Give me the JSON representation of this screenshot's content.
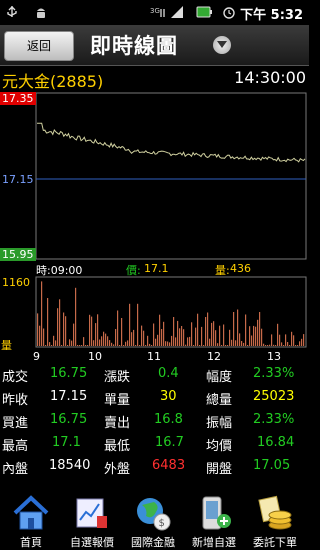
{
  "status_bar": {
    "time": "下午 5:32"
  },
  "header": {
    "back_label": "返回",
    "title": "即時線圖"
  },
  "stock": {
    "name": "元大金(2885)",
    "time": "14:30:00"
  },
  "chart": {
    "y_high": "17.35",
    "y_ref": "17.15",
    "y_low": "15.95",
    "ylim": [
      15.95,
      17.35
    ],
    "reference_price": 17.15,
    "price_line_color": "#d0d0a0",
    "reference_line_color": "#3060c0"
  },
  "info": {
    "time": "時:09:00",
    "price_label": "價:",
    "price_value": "17.1",
    "volume_label": "量:",
    "volume_value": "436"
  },
  "volume": {
    "max_label": "1160",
    "unit_label": "量",
    "bar_color": "#c66a4a"
  },
  "x_ticks": [
    "9",
    "10",
    "11",
    "12",
    "13"
  ],
  "quote": [
    [
      {
        "label": "成交",
        "value": "16.75",
        "color": "#22cc22"
      },
      {
        "label": "漲跌",
        "value": "0.4",
        "color": "#22cc22"
      },
      {
        "label": "幅度",
        "value": "2.33%",
        "color": "#22cc22"
      }
    ],
    [
      {
        "label": "昨收",
        "value": "17.15",
        "color": "#ffffff"
      },
      {
        "label": "單量",
        "value": "30",
        "color": "#ffff00"
      },
      {
        "label": "總量",
        "value": "25023",
        "color": "#ffff00"
      }
    ],
    [
      {
        "label": "買進",
        "value": "16.75",
        "color": "#22cc22"
      },
      {
        "label": "賣出",
        "value": "16.8",
        "color": "#22cc22"
      },
      {
        "label": "振幅",
        "value": "2.33%",
        "color": "#22cc22"
      }
    ],
    [
      {
        "label": "最高",
        "value": "17.1",
        "color": "#22cc22"
      },
      {
        "label": "最低",
        "value": "16.7",
        "color": "#22cc22"
      },
      {
        "label": "均價",
        "value": "16.84",
        "color": "#22cc22"
      }
    ],
    [
      {
        "label": "內盤",
        "value": "18540",
        "color": "#ffffff"
      },
      {
        "label": "外盤",
        "value": "6483",
        "color": "#ff3030"
      },
      {
        "label": "開盤",
        "value": "17.05",
        "color": "#22cc22"
      }
    ]
  ],
  "nav": [
    {
      "label": "首頁",
      "icon": "home-icon"
    },
    {
      "label": "自選報價",
      "icon": "watchlist-chart-icon"
    },
    {
      "label": "國際金融",
      "icon": "globe-finance-icon"
    },
    {
      "label": "新增自選",
      "icon": "add-watchlist-phone-icon"
    },
    {
      "label": "委託下單",
      "icon": "order-coins-icon"
    }
  ]
}
